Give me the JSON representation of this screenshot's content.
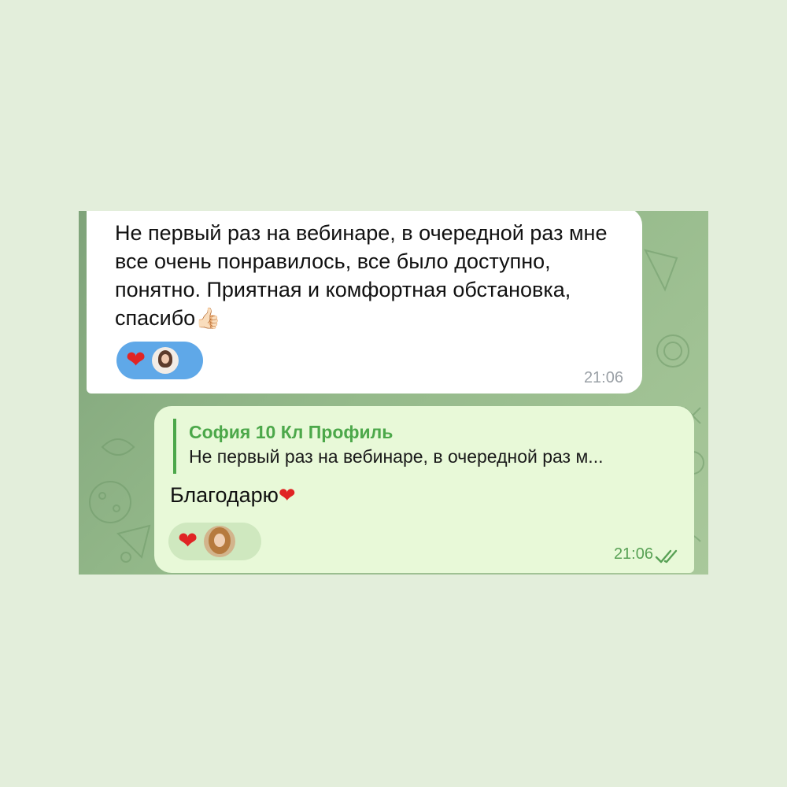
{
  "colors": {
    "page_background": "#e3eedb",
    "chat_background": "#8db384",
    "incoming_bubble": "#ffffff",
    "outgoing_bubble": "#e8f9d8",
    "accent_green": "#4ca84a",
    "reaction_blue": "#5fa8e8",
    "heart_red": "#e02424"
  },
  "messages": {
    "incoming": {
      "text": "Не первый раз на вебинаре, в очередной раз мне все очень понравилось, все было доступно, понятно. Приятная и комфортная обстановка, спасибо",
      "emoji": "👍🏻",
      "reaction": {
        "icon": "heart-icon",
        "glyph": "❤",
        "avatar": "reactor-avatar"
      },
      "time": "21:06"
    },
    "outgoing": {
      "reply": {
        "author": "София 10 Кл Профиль",
        "preview": "Не первый раз на вебинаре, в очередной раз м..."
      },
      "text": "Благодарю",
      "emoji": "❤",
      "reaction": {
        "icon": "heart-icon",
        "glyph": "❤",
        "avatar": "reactor-avatar"
      },
      "time": "21:06",
      "status_icon": "double-check-icon"
    }
  }
}
